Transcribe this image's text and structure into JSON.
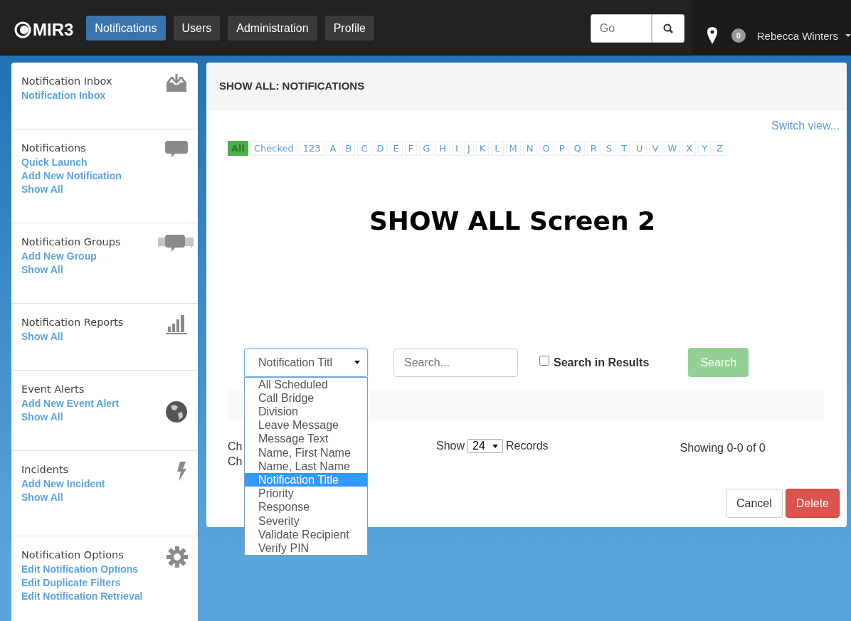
{
  "topbar": {
    "logo": "MIR3",
    "nav": [
      {
        "label": "Notifications",
        "selected": true
      },
      {
        "label": "Users",
        "selected": false
      },
      {
        "label": "Administration",
        "selected": false
      },
      {
        "label": "Profile",
        "selected": false
      }
    ],
    "search": {
      "placeholder": "Go"
    },
    "badge": "0",
    "user": "Rebecca Winters"
  },
  "sidebar": [
    {
      "title": "Notification Inbox",
      "links": [
        "Notification Inbox"
      ]
    },
    {
      "title": "Notifications",
      "links": [
        "Quick Launch",
        "Add New Notification",
        "Show All"
      ]
    },
    {
      "title": "Notification Groups",
      "links": [
        "Add New Group",
        "Show All"
      ]
    },
    {
      "title": "Notification Reports",
      "links": [
        "Show All"
      ]
    },
    {
      "title": "Event Alerts",
      "links": [
        "Add New Event Alert",
        "Show All"
      ]
    },
    {
      "title": "Incidents",
      "links": [
        "Add New Incident",
        "Show All"
      ]
    },
    {
      "title": "Notification Options",
      "links": [
        "Edit Notification Options",
        "Edit Duplicate Filters",
        "Edit Notification Retrieval"
      ]
    }
  ],
  "panel": {
    "header": "SHOW ALL: NOTIFICATIONS",
    "switch_view": "Switch view...",
    "letters": [
      {
        "label": "All",
        "selected": true
      },
      {
        "label": "Checked",
        "selected": false
      },
      {
        "label": "123",
        "selected": false
      },
      {
        "label": "A",
        "selected": false
      },
      {
        "label": "B",
        "selected": false
      },
      {
        "label": "C",
        "selected": false
      },
      {
        "label": "D",
        "selected": false
      },
      {
        "label": "E",
        "selected": false
      },
      {
        "label": "F",
        "selected": false
      },
      {
        "label": "G",
        "selected": false
      },
      {
        "label": "H",
        "selected": false
      },
      {
        "label": "I",
        "selected": false
      },
      {
        "label": "J",
        "selected": false
      },
      {
        "label": "K",
        "selected": false
      },
      {
        "label": "L",
        "selected": false
      },
      {
        "label": "M",
        "selected": false
      },
      {
        "label": "N",
        "selected": false
      },
      {
        "label": "O",
        "selected": false
      },
      {
        "label": "P",
        "selected": false
      },
      {
        "label": "Q",
        "selected": false
      },
      {
        "label": "R",
        "selected": false
      },
      {
        "label": "S",
        "selected": false
      },
      {
        "label": "T",
        "selected": false
      },
      {
        "label": "U",
        "selected": false
      },
      {
        "label": "V",
        "selected": false
      },
      {
        "label": "W",
        "selected": false
      },
      {
        "label": "X",
        "selected": false
      },
      {
        "label": "Y",
        "selected": false
      },
      {
        "label": "Z",
        "selected": false
      }
    ],
    "heading": "SHOW ALL Screen 2",
    "field_select": {
      "value": "Notification Titl",
      "expanded": true,
      "options": [
        {
          "label": "All Scheduled",
          "selected": false
        },
        {
          "label": "Call Bridge",
          "selected": false
        },
        {
          "label": "Division",
          "selected": false
        },
        {
          "label": "Leave Message",
          "selected": false
        },
        {
          "label": "Message Text",
          "selected": false
        },
        {
          "label": "Name, First Name",
          "selected": false
        },
        {
          "label": "Name, Last Name",
          "selected": false
        },
        {
          "label": "Notification Title",
          "selected": true
        },
        {
          "label": "Priority",
          "selected": false
        },
        {
          "label": "Response",
          "selected": false
        },
        {
          "label": "Severity",
          "selected": false
        },
        {
          "label": "Validate Recipient",
          "selected": false
        },
        {
          "label": "Verify PIN",
          "selected": false
        }
      ]
    },
    "search": {
      "placeholder": "Search..."
    },
    "search_in_results": {
      "label": "Search in Results",
      "checked": false
    },
    "search_button": {
      "label": "Search",
      "disabled": true
    },
    "check_lines": [
      "Ch",
      "Ch"
    ],
    "show": {
      "before": "Show",
      "value": "24",
      "after": "Records"
    },
    "showing": "Showing 0-0 of 0",
    "buttons": [
      {
        "label": "Cancel",
        "kind": "default"
      },
      {
        "label": "Delete",
        "kind": "danger"
      }
    ]
  }
}
